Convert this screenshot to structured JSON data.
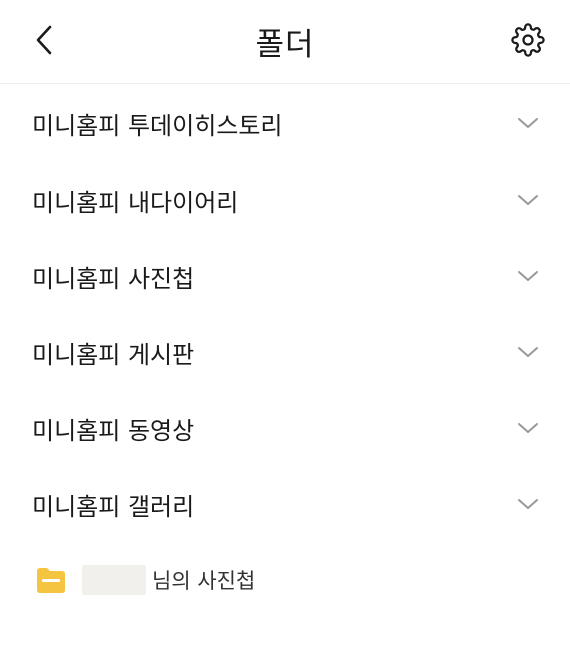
{
  "header": {
    "title": "폴더",
    "back_icon": "chevron-left-icon",
    "settings_icon": "gear-icon"
  },
  "folders": [
    {
      "label": "미니홈피 투데이히스토리"
    },
    {
      "label": "미니홈피 내다이어리"
    },
    {
      "label": "미니홈피 사진첩"
    },
    {
      "label": "미니홈피 게시판"
    },
    {
      "label": "미니홈피 동영상"
    },
    {
      "label": "미니홈피 갤러리"
    }
  ],
  "photo_album": {
    "label": "님의 사진첩",
    "icon": "folder-icon",
    "icon_color": "#F5C542"
  },
  "colors": {
    "text": "#1a1a1a",
    "chevron": "#999999",
    "divider": "#eeeeee",
    "background": "#ffffff"
  }
}
